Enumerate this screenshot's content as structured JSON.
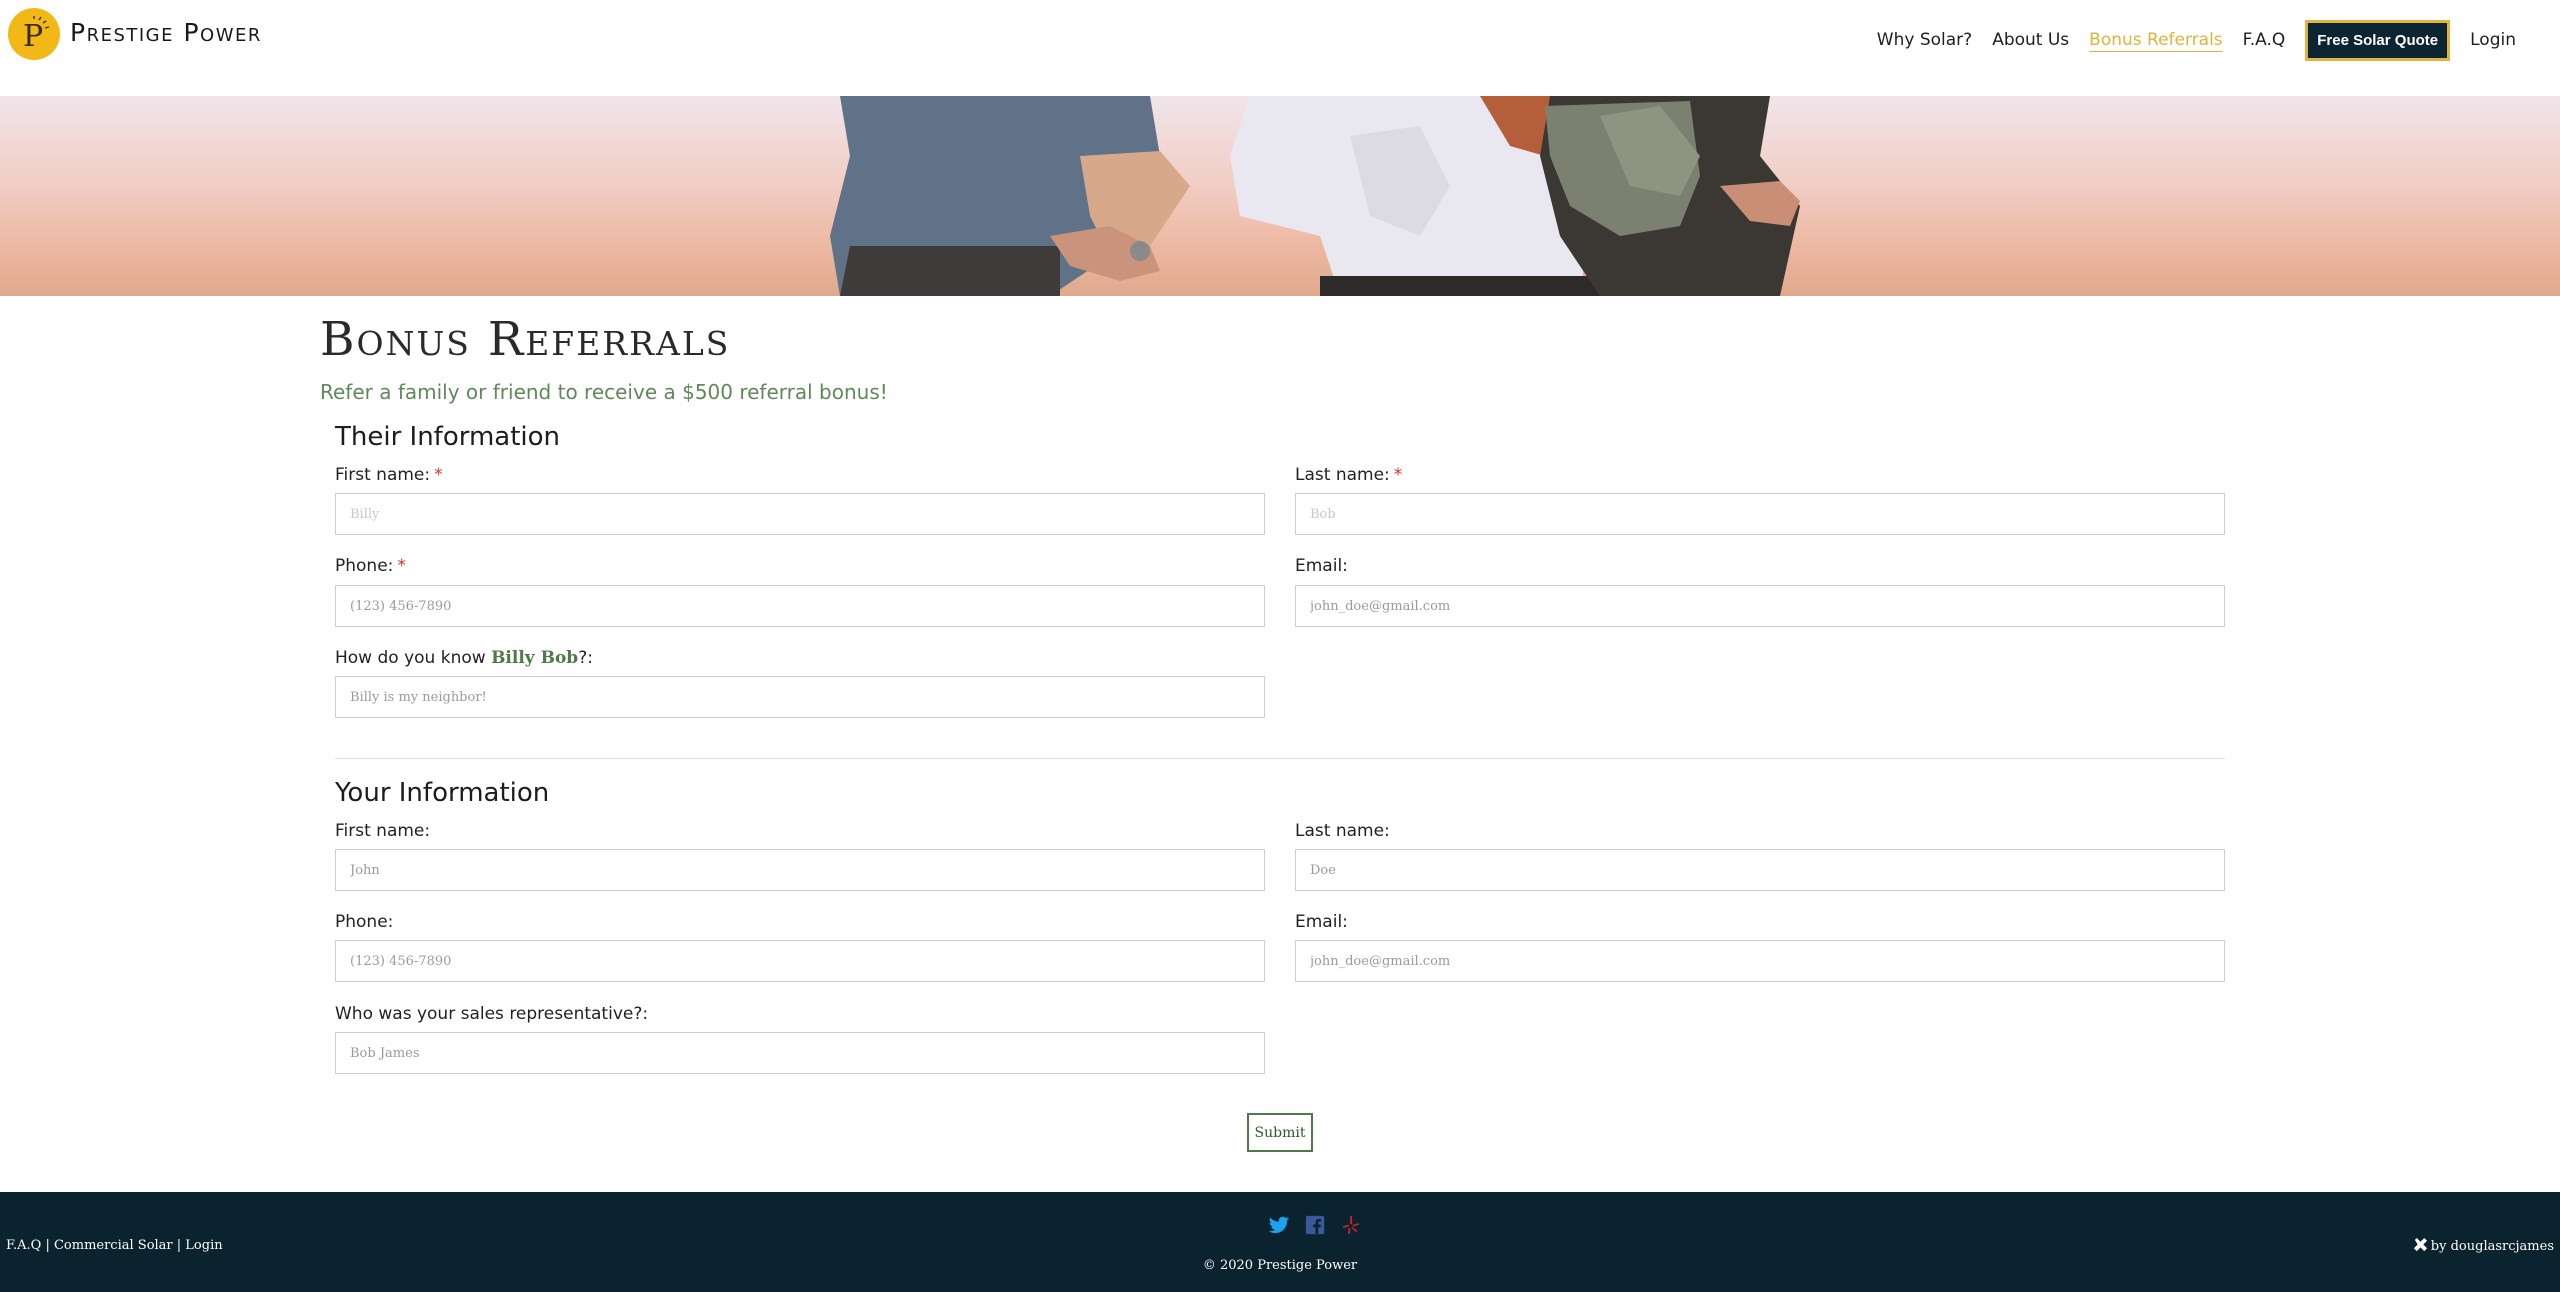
{
  "header": {
    "brand": "Prestige Power",
    "nav": {
      "why_solar": "Why Solar?",
      "about_us": "About Us",
      "bonus_referrals": "Bonus Referrals",
      "faq": "F.A.Q",
      "quote_button": "Free Solar Quote",
      "login": "Login"
    }
  },
  "main": {
    "title": "Bonus Referrals",
    "subtitle": "Refer a family or friend to receive a $500 referral bonus!",
    "their_info": {
      "heading": "Their Information",
      "first_name": {
        "label": "First name:",
        "placeholder": "Billy",
        "required": true
      },
      "last_name": {
        "label": "Last name:",
        "placeholder": "Bob",
        "required": true
      },
      "phone": {
        "label": "Phone:",
        "placeholder": "(123) 456-7890",
        "required": true
      },
      "email": {
        "label": "Email:",
        "placeholder": "john_doe@gmail.com"
      },
      "how_know": {
        "label_prefix": "How do you know ",
        "name": "Billy Bob",
        "label_suffix": "?:",
        "placeholder": "Billy is my neighbor!"
      }
    },
    "your_info": {
      "heading": "Your Information",
      "first_name": {
        "label": "First name:",
        "placeholder": "John"
      },
      "last_name": {
        "label": "Last name:",
        "placeholder": "Doe"
      },
      "phone": {
        "label": "Phone:",
        "placeholder": "(123) 456-7890"
      },
      "email": {
        "label": "Email:",
        "placeholder": "john_doe@gmail.com"
      },
      "sales_rep": {
        "label": "Who was your sales representative?:",
        "placeholder": "Bob James"
      }
    },
    "submit_label": "Submit",
    "required_mark": "*"
  },
  "footer": {
    "links": [
      "F.A.Q",
      "Commercial Solar",
      "Login"
    ],
    "separator": " | ",
    "copyright": "© 2020 Prestige Power",
    "credit": "by douglasrcjames",
    "socials": [
      "twitter-icon",
      "facebook-icon",
      "yelp-icon"
    ]
  },
  "colors": {
    "accent_gold": "#e3b23c",
    "footer_bg": "#0b232f",
    "subtitle_green": "#5e8a58",
    "required_red": "#d8302b"
  }
}
